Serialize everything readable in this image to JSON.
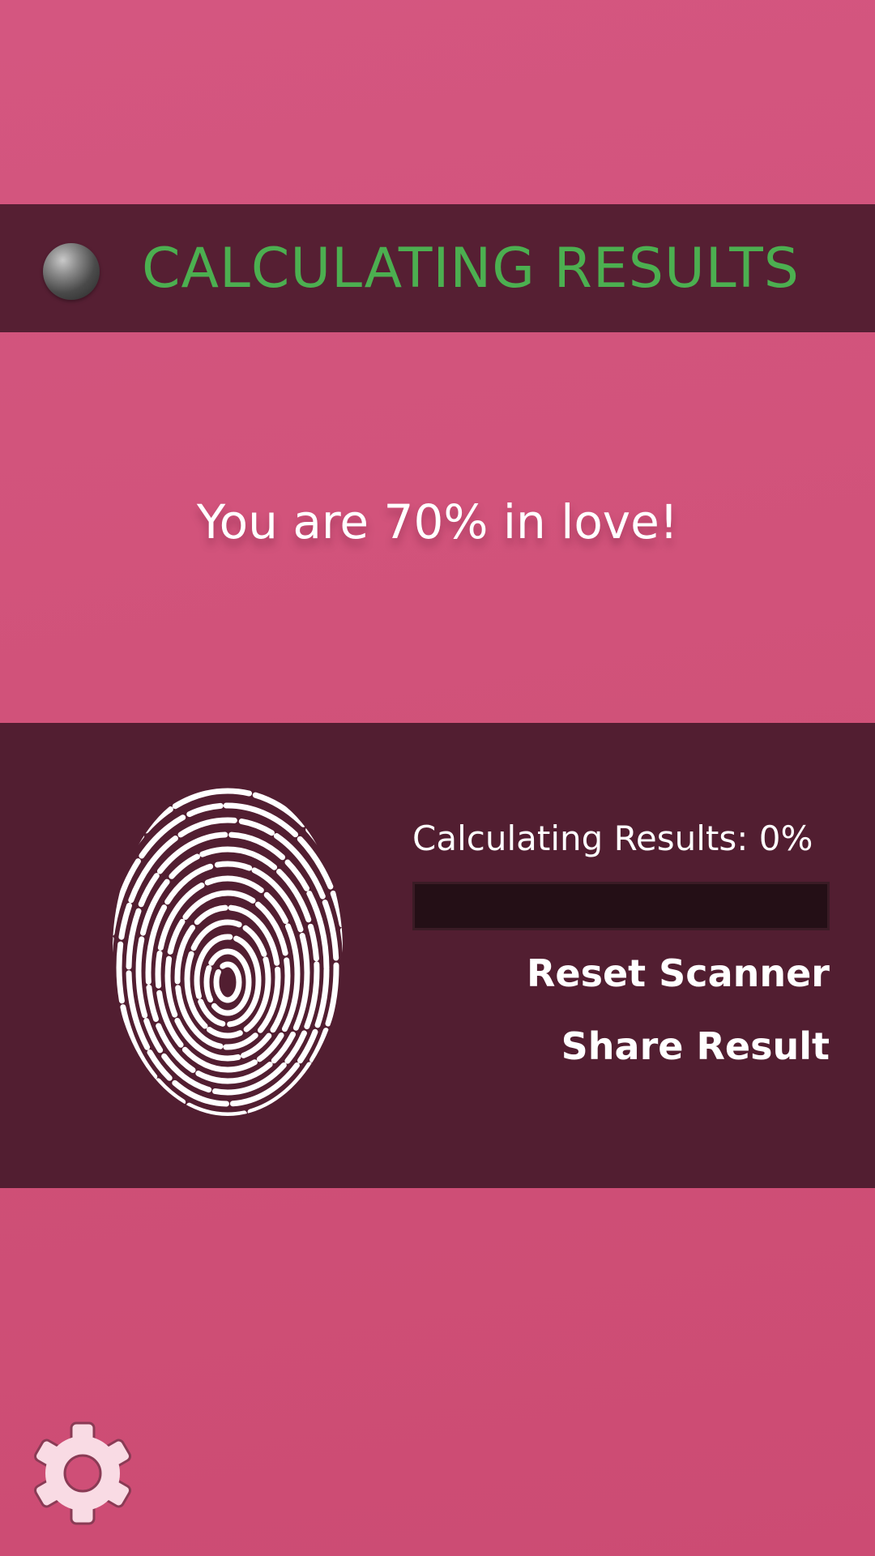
{
  "status": {
    "title": "CALCULATING RESULTS",
    "title_color": "#4caf50",
    "orb_icon": "gray-sphere-icon"
  },
  "result": {
    "text": "You are 70% in love!"
  },
  "scanner": {
    "fingerprint_icon": "fingerprint-icon",
    "progress_label": "Calculating Results: 0%",
    "progress_value": 0,
    "reset_label": "Reset Scanner",
    "share_label": "Share Result"
  },
  "settings": {
    "icon": "gear-icon"
  },
  "colors": {
    "background": "#d25179",
    "panel": "#521e31",
    "progress_track": "#240f16",
    "accent_text": "#ffffff"
  }
}
